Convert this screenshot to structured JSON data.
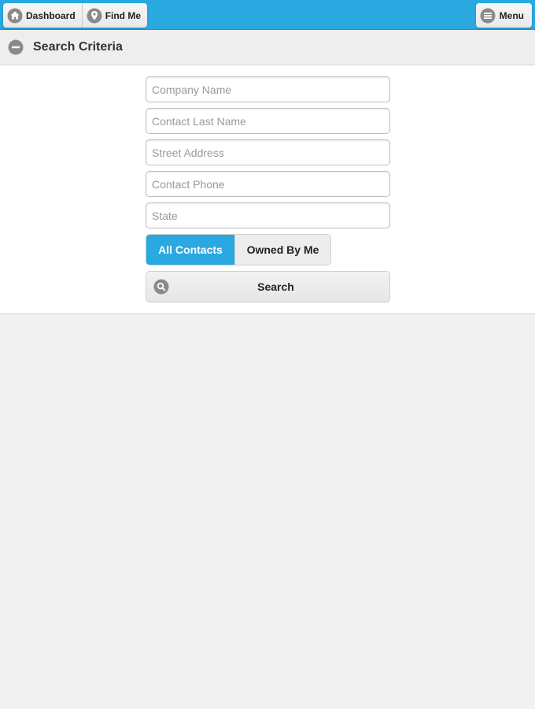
{
  "toolbar": {
    "dashboard_label": "Dashboard",
    "findme_label": "Find Me",
    "menu_label": "Menu",
    "icons": {
      "dashboard": "home-icon",
      "findme": "location-pin-icon",
      "menu": "hamburger-icon"
    },
    "accent_color": "#2aa8e0"
  },
  "section": {
    "title": "Search Criteria",
    "icon": "collapse-minus-icon"
  },
  "form": {
    "fields": [
      {
        "placeholder": "Company Name",
        "value": ""
      },
      {
        "placeholder": "Contact Last Name",
        "value": ""
      },
      {
        "placeholder": "Street Address",
        "value": ""
      },
      {
        "placeholder": "Contact Phone",
        "value": ""
      },
      {
        "placeholder": "State",
        "value": ""
      }
    ],
    "scope": {
      "options": [
        "All Contacts",
        "Owned By Me"
      ],
      "selected": "All Contacts"
    },
    "search_label": "Search",
    "search_icon": "search-icon"
  }
}
